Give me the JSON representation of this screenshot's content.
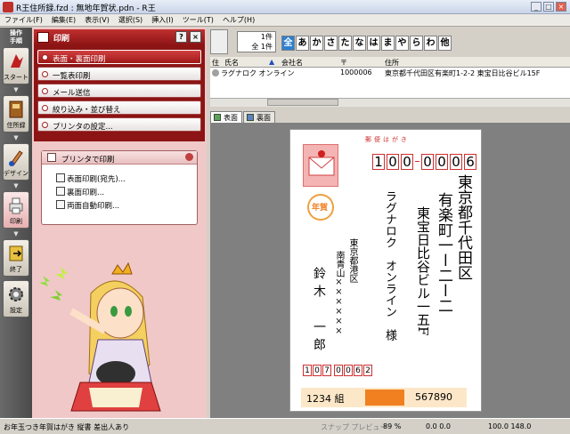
{
  "window": {
    "title": "R王住所録.fzd : 無地年賀状.pdn - R王"
  },
  "menu": [
    "ファイル(F)",
    "編集(E)",
    "表示(V)",
    "選択(S)",
    "挿入(I)",
    "ツール(T)",
    "ヘルプ(H)"
  ],
  "leftbar": {
    "header": "操作\n手順",
    "buttons": [
      {
        "label": "スタート",
        "icon": "start-arrow-icon"
      },
      {
        "label": "住所録",
        "icon": "address-book-icon"
      },
      {
        "label": "デザイン",
        "icon": "design-brush-icon"
      },
      {
        "label": "印刷",
        "icon": "printer-icon"
      },
      {
        "label": "終了",
        "icon": "exit-icon"
      },
      {
        "label": "設定",
        "icon": "gear-icon"
      }
    ]
  },
  "panel": {
    "title": "印刷",
    "help": "?",
    "menu_items": [
      "表面・裏面印刷",
      "一覧表印刷",
      "メール送信",
      "絞り込み・並び替え",
      "プリンタの設定..."
    ],
    "sub_title": "プリンタで印刷",
    "sub_items": [
      "表面印刷(宛先)...",
      "裏面印刷...",
      "両面自動印刷..."
    ]
  },
  "list": {
    "count_line1": "1件",
    "count_line2": "全 1件",
    "kana": [
      "全",
      "あ",
      "か",
      "さ",
      "た",
      "な",
      "は",
      "ま",
      "や",
      "ら",
      "わ",
      "他"
    ],
    "columns": [
      "住",
      "氏名",
      "会社名",
      "〒",
      "住所"
    ],
    "rows": [
      [
        "",
        "ラグナロク オンライン",
        "",
        "1000006",
        "東京都千代田区有楽町1-2-2 東宝日比谷ビル15F"
      ]
    ]
  },
  "tabs": [
    "表面",
    "裏面"
  ],
  "postcard": {
    "header": "郵便はがき",
    "postal_code": [
      "1",
      "0",
      "0",
      "0",
      "0",
      "0",
      "6"
    ],
    "address_line1": "東京都千代田区",
    "address_line2": "有楽町一ー二ー二",
    "address_line3": "東宝日比谷ビル一五F",
    "recipient": "ラグナロク　オンライン　様",
    "sender_address1": "東京都港区",
    "sender_address2": "南青山××××××",
    "sender_name": "鈴木　一郎",
    "sender_postal": [
      "1",
      "0",
      "7",
      "0",
      "0",
      "6",
      "2"
    ],
    "nenga": "年賀",
    "lottery_left": "1234 組",
    "lottery_right": "567890"
  },
  "status": {
    "left": "お年玉つき年賀はがき 縦書 差出人あり",
    "snap": "スナップ プレビュー",
    "zoom": "89 %",
    "pos": "0.0 0.0",
    "size": "100.0 148.0"
  },
  "colors": {
    "accent": "#8c1414",
    "panel_bg": "#f0c8c8",
    "postal_red": "#d03030",
    "kana_active": "#2e7fd0"
  }
}
